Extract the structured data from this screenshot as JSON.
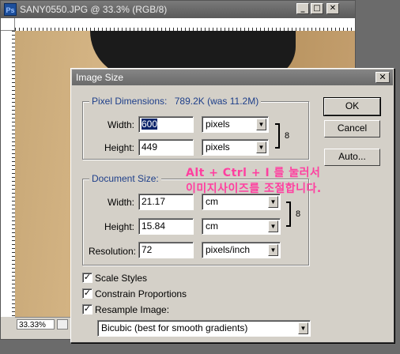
{
  "document_window": {
    "title": "SANY0550.JPG @ 33.3% (RGB/8)",
    "app_icon_text": "Ps",
    "zoom": "33.33%",
    "controls": {
      "minimize": "_",
      "maximize": "□",
      "close": "✕"
    }
  },
  "dialog": {
    "title": "Image Size",
    "close_glyph": "✕",
    "pixel_dimensions": {
      "label": "Pixel Dimensions:",
      "size": "789.2K (was 11.2M)",
      "width_label": "Width:",
      "width_value": "600",
      "width_unit": "pixels",
      "height_label": "Height:",
      "height_value": "449",
      "height_unit": "pixels"
    },
    "document_size": {
      "label": "Document Size:",
      "width_label": "Width:",
      "width_value": "21.17",
      "width_unit": "cm",
      "height_label": "Height:",
      "height_value": "15.84",
      "height_unit": "cm",
      "resolution_label": "Resolution:",
      "resolution_value": "72",
      "resolution_unit": "pixels/inch"
    },
    "buttons": {
      "ok": "OK",
      "cancel": "Cancel",
      "auto": "Auto..."
    },
    "options": {
      "scale_styles": {
        "label": "Scale Styles",
        "checked": true
      },
      "constrain_proportions": {
        "label": "Constrain Proportions",
        "checked": true
      },
      "resample_image": {
        "label": "Resample Image:",
        "checked": true
      }
    },
    "resample_method": "Bicubic (best for smooth gradients)",
    "check_glyph": "✓",
    "arrow_glyph": "▼",
    "link_glyph": "8"
  },
  "annotation": {
    "line1": "Alt + Ctrl + I 를 눌러서",
    "line2": "이미지사이즈를 조절합니다.",
    "color": "#ff3fa0"
  }
}
